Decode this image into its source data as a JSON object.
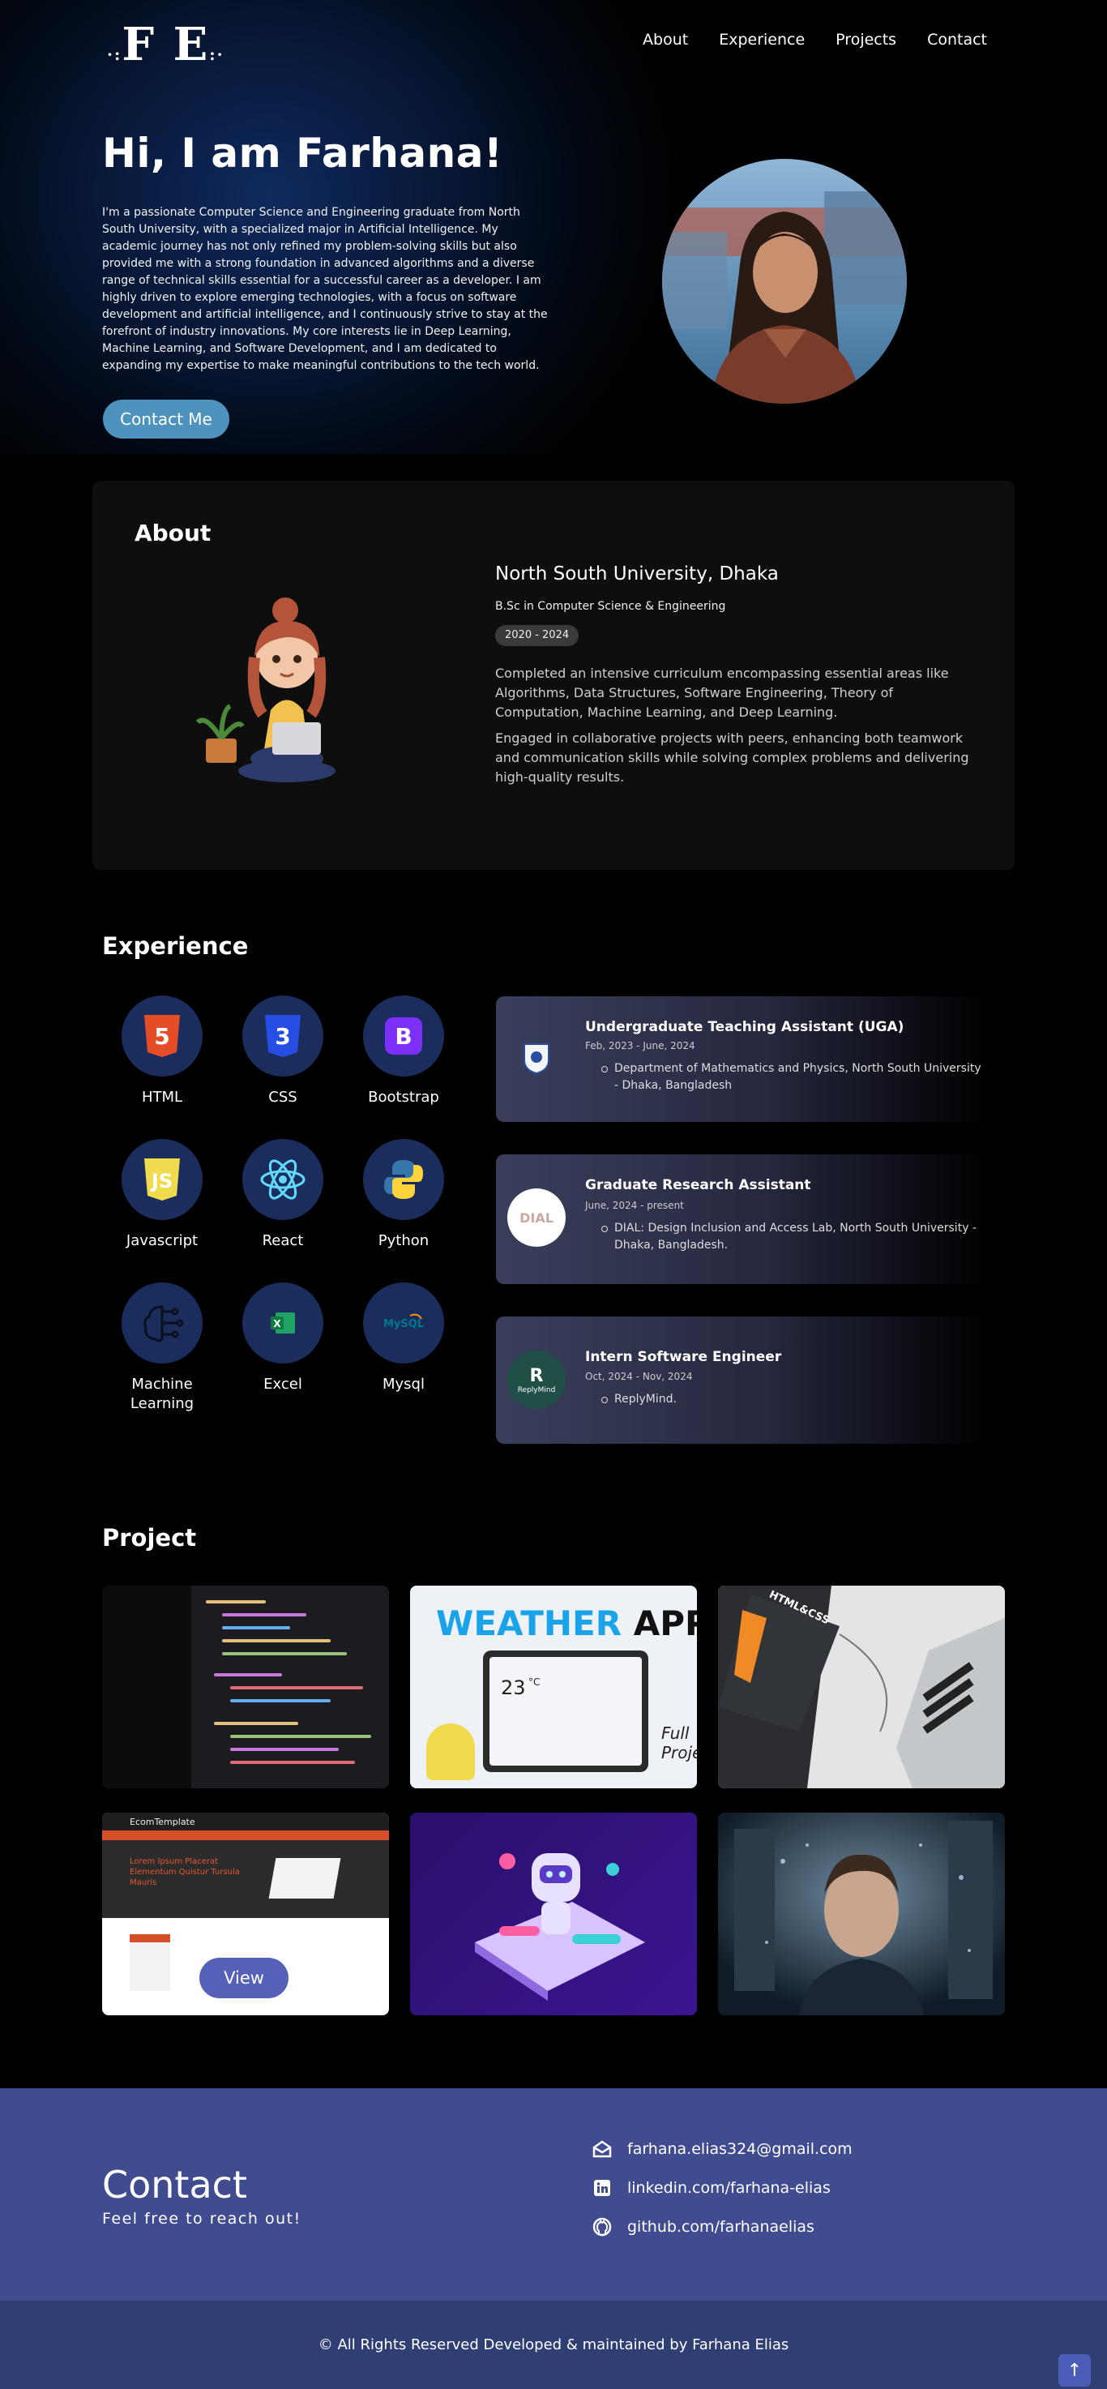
{
  "nav": {
    "logo": "F E",
    "items": [
      "About",
      "Experience",
      "Projects",
      "Contact"
    ]
  },
  "hero": {
    "heading": "Hi, I am Farhana!",
    "bio": "I'm a passionate Computer Science and Engineering graduate from North South University, with a specialized major in Artificial Intelligence. My academic journey has not only refined my problem-solving skills but also provided me with a strong foundation in advanced algorithms and a diverse range of technical skills essential for a successful career as a developer. I am highly driven to explore emerging technologies, with a focus on software development and artificial intelligence, and I continuously strive to stay at the forefront of industry innovations. My core interests lie in Deep Learning, Machine Learning, and Software Development, and I am dedicated to expanding my expertise to make meaningful contributions to the tech world.",
    "contact_button": "Contact Me"
  },
  "about": {
    "title": "About",
    "university": "North South University, Dhaka",
    "degree": "B.Sc in Computer Science & Engineering",
    "years": "2020 - 2024",
    "para1": "Completed an intensive curriculum encompassing essential areas like Algorithms, Data Structures, Software Engineering, Theory of Computation, Machine Learning, and Deep Learning.",
    "para2": "Engaged in collaborative projects with peers, enhancing both teamwork and communication skills while solving complex problems and delivering high-quality results."
  },
  "experience": {
    "title": "Experience",
    "skills": [
      "HTML",
      "CSS",
      "Bootstrap",
      "Javascript",
      "React",
      "Python",
      "Machine Learning",
      "Excel",
      "Mysql"
    ],
    "jobs": [
      {
        "title": "Undergraduate Teaching Assistant (UGA)",
        "date": "Feb, 2023 - June, 2024",
        "desc": "Department of Mathematics and Physics, North South University - Dhaka, Bangladesh"
      },
      {
        "title": "Graduate Research Assistant",
        "date": "June, 2024 - present",
        "desc": "DIAL: Design Inclusion and Access Lab, North South University - Dhaka, Bangladesh.",
        "logo_text": "DIAL"
      },
      {
        "title": "Intern Software Engineer",
        "date": "Oct, 2024 - Nov, 2024",
        "desc": "ReplyMind.",
        "logo_text": "ReplyMind"
      }
    ]
  },
  "projects": {
    "title": "Project",
    "weather_title_a": "WEATHER",
    "weather_title_b": "APP",
    "weather_temp": "23",
    "weather_note": "Full Proje",
    "book_label": "HTML&CSS",
    "ecom_title": "EcomTemplate",
    "ecom_headline": "Lorem Ipsum Placerat Elementum Quistur Tursula Mauris",
    "view_button": "View"
  },
  "contact": {
    "title": "Contact",
    "subtitle": "Feel free to reach out!",
    "email": "farhana.elias324@gmail.com",
    "linkedin": "linkedin.com/farhana-elias",
    "github": "github.com/farhanaelias"
  },
  "footer": {
    "text": "© All Rights Reserved Developed & maintained by Farhana Elias",
    "to_top": "↑"
  },
  "colors": {
    "accent_button": "#4e93bd",
    "skill_circle": "#1b2d5c",
    "contact_bg": "#404c8f",
    "footer_bg": "#2f3f74"
  }
}
